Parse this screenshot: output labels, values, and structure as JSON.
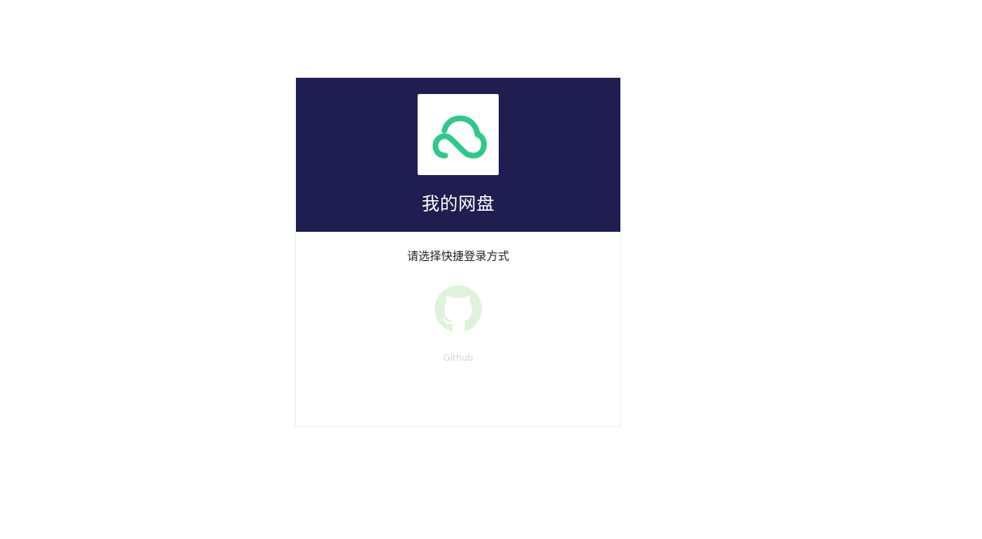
{
  "app": {
    "title": "我的网盘",
    "logo_icon": "cloud-icon",
    "brand_color": "#2ec88a",
    "header_color": "#201e50"
  },
  "login": {
    "prompt": "请选择快捷登录方式",
    "providers": [
      {
        "label": "Github",
        "icon": "github-icon",
        "icon_bg": "#dff2dc"
      }
    ]
  }
}
